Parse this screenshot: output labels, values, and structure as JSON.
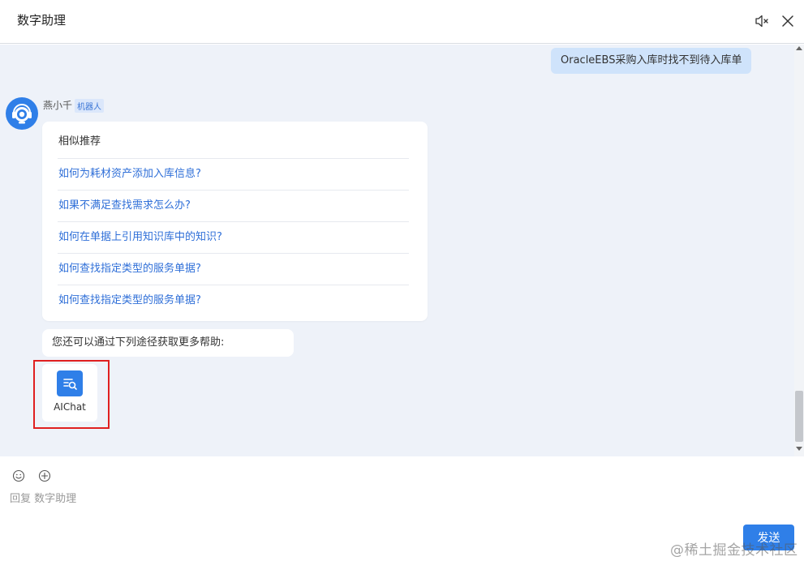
{
  "header": {
    "title": "数字助理",
    "mute_icon": "speaker-mute-icon",
    "close_icon": "close-icon"
  },
  "chat": {
    "user_message": "OracleEBS采购入库时找不到待入库单",
    "bot": {
      "name": "燕小千",
      "tag": "机器人",
      "avatar_icon": "robot-headset-icon"
    },
    "recommend": {
      "title": "相似推荐",
      "items": [
        "如何为耗材资产添加入库信息?",
        "如果不满足查找需求怎么办?",
        "如何在单据上引用知识库中的知识?",
        "如何查找指定类型的服务单据?",
        "如何查找指定类型的服务单据?"
      ]
    },
    "help_text": "您还可以通过下列途径获取更多帮助:",
    "aichat": {
      "label": "AIChat",
      "icon": "search-list-icon"
    }
  },
  "composer": {
    "placeholder": "回复 数字助理",
    "value": "",
    "emoji_icon": "smile-icon",
    "plus_icon": "plus-circle-icon",
    "send_label": "发送"
  },
  "watermark": "@稀土掘金技术社区",
  "colors": {
    "accent": "#2f7fe8",
    "chat_bg": "#eef2f9",
    "user_bubble": "#cfe3fb",
    "link": "#2f6fd8",
    "highlight": "#e02020"
  }
}
